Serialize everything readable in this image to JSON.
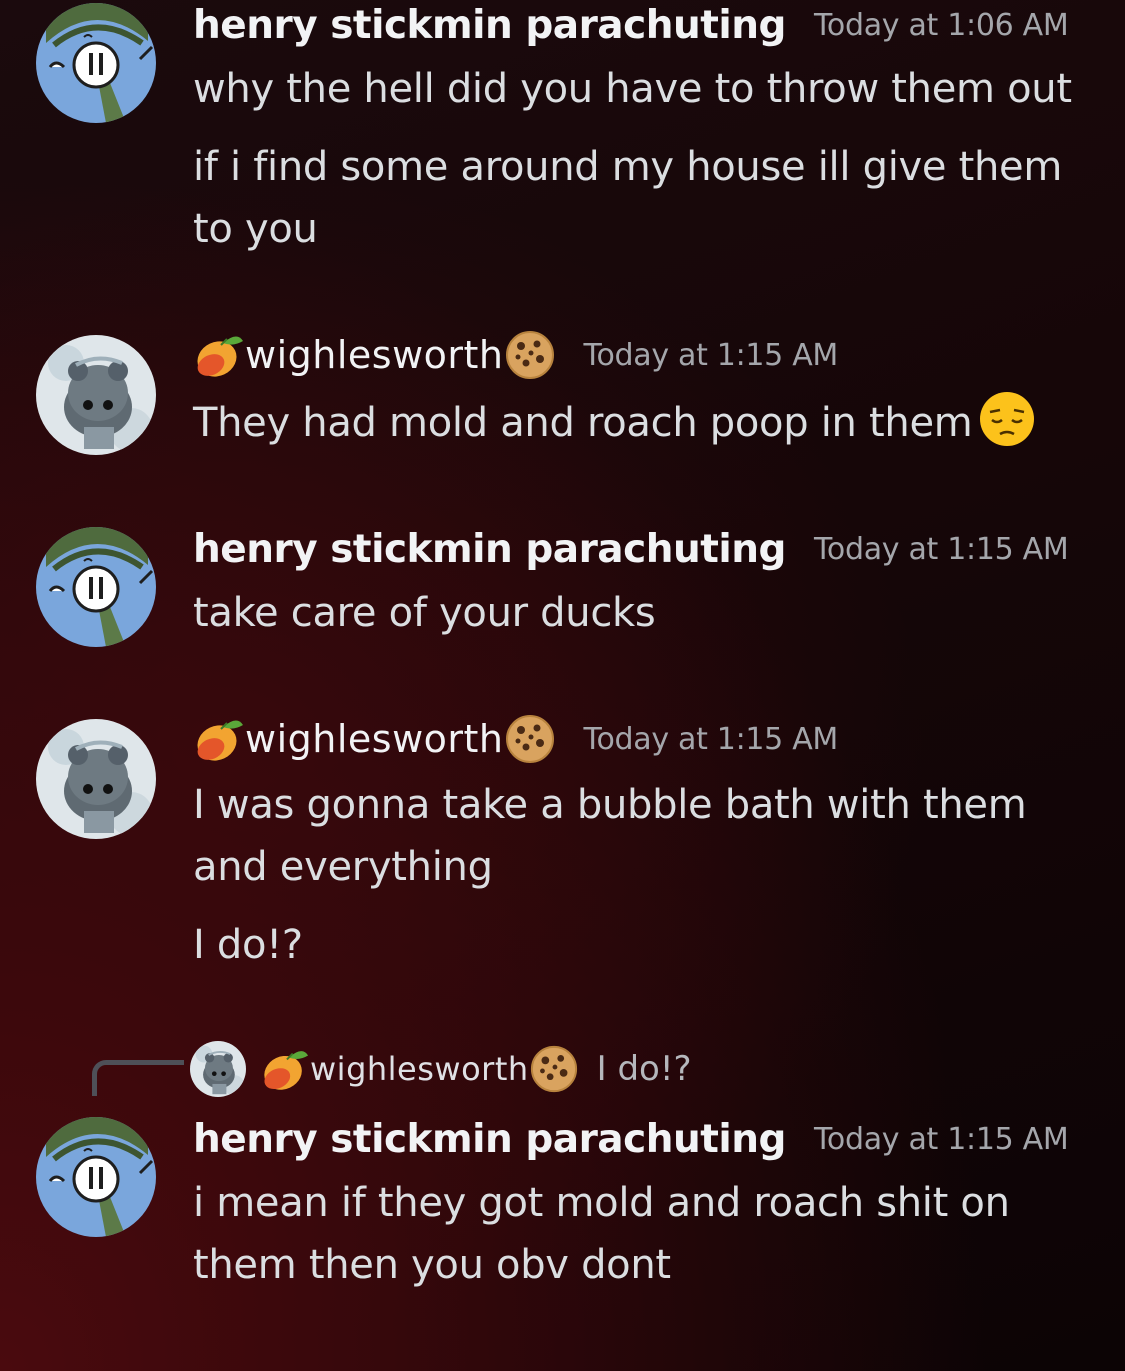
{
  "users": {
    "henry": {
      "name": "henry stickmin parachuting",
      "avatar_icon": "henry-stickmin-avatar-icon"
    },
    "wigh": {
      "name": "wighlesworth",
      "avatar_icon": "grey-creature-avatar-icon",
      "prefix_emoji": "mango-emoji-icon",
      "suffix_emoji": "cookie-emoji-icon"
    }
  },
  "messages": [
    {
      "author": "henry stickmin parachuting",
      "timestamp": "Today at 1:06 AM",
      "lines": [
        "why the hell did you have to throw them out",
        "if i find some around my house ill give them to you"
      ]
    },
    {
      "author": "wighlesworth",
      "timestamp": "Today at 1:15 AM",
      "lines": [
        "They had mold and roach poop in them"
      ],
      "trailing_emoji": "pensive-face-emoji-icon"
    },
    {
      "author": "henry stickmin parachuting",
      "timestamp": "Today at 1:15 AM",
      "lines": [
        "take care of your ducks"
      ]
    },
    {
      "author": "wighlesworth",
      "timestamp": "Today at 1:15 AM",
      "lines": [
        "I was gonna take a bubble bath with them and everything",
        "I do!?"
      ]
    },
    {
      "author": "henry stickmin parachuting",
      "timestamp": "Today at 1:15 AM",
      "reply_to": {
        "author": "wighlesworth",
        "text": "I do!?"
      },
      "lines": [
        "i mean if they got mold and roach shit on them then you obv dont"
      ]
    }
  ],
  "colors": {
    "username": "#f2f3f5",
    "timestamp": "#a4a6ab",
    "body_text": "#dbdee1",
    "henry_avatar_bg": "#7aa6dc",
    "background_accent": "#4a0a0e"
  }
}
